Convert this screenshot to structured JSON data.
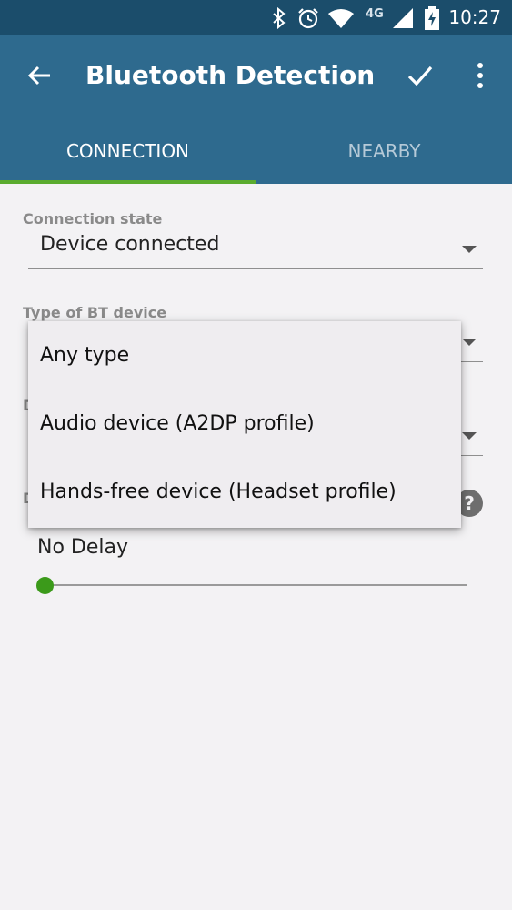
{
  "status_bar": {
    "time": "10:27",
    "network": "4G",
    "icons": [
      "bluetooth-icon",
      "alarm-icon",
      "wifi-icon",
      "4g-icon",
      "signal-icon",
      "battery-icon"
    ]
  },
  "toolbar": {
    "title": "Bluetooth Detection",
    "back_icon": "arrow-left-icon",
    "confirm_icon": "check-icon",
    "menu_icon": "more-vert-icon"
  },
  "tabs": [
    {
      "label": "CONNECTION",
      "selected": true
    },
    {
      "label": "NEARBY",
      "selected": false
    }
  ],
  "form": {
    "connection_state": {
      "label": "Connection state",
      "value": "Device connected"
    },
    "bt_device_type": {
      "label": "Type of BT device"
    },
    "partial_label_1": "D",
    "partial_label_2": "D",
    "help_glyph": "?",
    "delay": {
      "value_text": "No Delay",
      "level": 0
    }
  },
  "dropdown": {
    "options": [
      "Any type",
      "Audio device (A2DP profile)",
      "Hands-free device (Headset profile)"
    ]
  },
  "colors": {
    "status_bar": "#1b4d6b",
    "toolbar": "#2e6a8e",
    "accent": "#5aab2e",
    "slider": "#3b9a1a",
    "background": "#f3f2f4"
  }
}
